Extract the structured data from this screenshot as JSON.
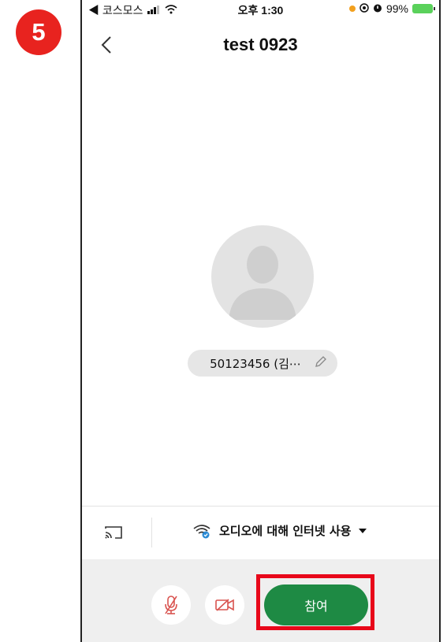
{
  "step_badge": "5",
  "status_bar": {
    "carrier": "◀ 코스모스",
    "time": "오후 1:30",
    "battery": "99%"
  },
  "nav": {
    "title": "test 0923"
  },
  "participant": {
    "name": "50123456 (김⋯"
  },
  "options": {
    "audio_label": "오디오에 대해 인터넷 사용"
  },
  "controls": {
    "join_label": "참여"
  },
  "colors": {
    "badge": "#e8231f",
    "join_button": "#1e8a44",
    "highlight": "#e8081a",
    "mute_icon": "#d9534f",
    "wifi_check": "#2a8ad4"
  },
  "icons": [
    "back-chevron-icon",
    "signal-icon",
    "wifi-icon",
    "avatar-placeholder-icon",
    "edit-pencil-icon",
    "cast-icon",
    "wifi-audio-icon",
    "dropdown-caret-icon",
    "mic-muted-icon",
    "camera-off-icon"
  ]
}
